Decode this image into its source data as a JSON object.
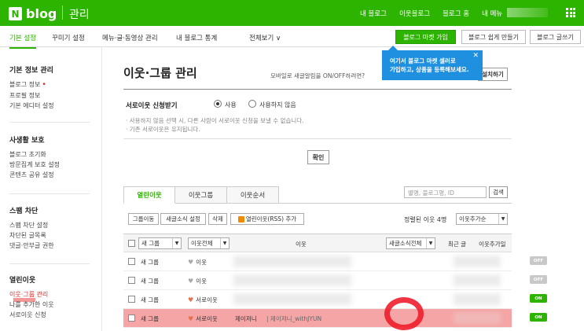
{
  "topbar": {
    "logo_n": "N",
    "logo_text": "blog",
    "title": "관리",
    "links": [
      "내 블로그",
      "이웃블로그",
      "블로그 홈",
      "내 메뉴"
    ],
    "bg_color": "#2db400"
  },
  "subnav": {
    "items": [
      "기본 설정",
      "꾸미기 설정",
      "메뉴·글·동영상 관리",
      "내 블로그 통계",
      "전체보기 ∨"
    ],
    "market_button": "블로그 마켓 가입",
    "easy_button": "블로그 쉽게 만들기",
    "write_button": "블로그 글쓰기"
  },
  "tooltip": {
    "line1": "여기서 블로그 마켓 셀러로",
    "line2": "가입하고, 상품을 등록해보세요.",
    "close": "✕"
  },
  "sidebar": {
    "group1": {
      "title": "기본 정보 관리",
      "items": [
        "블로그 정보",
        "프로필 정보",
        "기본 에디터 설정"
      ]
    },
    "group2": {
      "title": "사생활 보호",
      "items": [
        "블로그 초기화",
        "방문집계 보호 설정",
        "콘텐츠 공유 설정"
      ]
    },
    "group3": {
      "title": "스팸 차단",
      "items": [
        "스팸 차단 설정",
        "차단된 글목록",
        "댓글·안부글 권한"
      ]
    },
    "group4": {
      "title": "열린이웃",
      "items": [
        "이웃·그룹 관리",
        "나를 추가한 이웃",
        "서로이웃 신청"
      ]
    }
  },
  "main": {
    "title": "이웃·그룹 관리",
    "notice": "모바일로 새글알림을 ON/OFF하려면?",
    "install_button": "설치하기",
    "option_label": "서로이웃 신청받기",
    "radio_use": "사용",
    "radio_nouse": "사용하지 않음",
    "desc1": "· 사용하지 않음 선택 시, 다른 사람이 서로이웃 신청을 보낼 수 없습니다.",
    "desc2": "· 기존 서로이웃은 유지됩니다.",
    "confirm": "확인"
  },
  "tabs": [
    "열린이웃",
    "이웃그룹",
    "이웃순서"
  ],
  "search": {
    "placeholder": "별명, 블로그명, ID",
    "button": "검색"
  },
  "toolbar": {
    "group_move": "그룹이동",
    "feed_setting": "새글소식 설정",
    "delete": "삭제",
    "rss_add": "열린이웃(RSS) 추가",
    "sort_text": "정렬된 이웃 4명",
    "sort_select": "이웃추가순"
  },
  "table": {
    "headers": {
      "group_select": "새 그룹",
      "neighbor_all": "이웃전체",
      "neighbor": "이웃",
      "feed_all": "새글소식전체",
      "recent": "최근 글",
      "added_date": "이웃추가일"
    },
    "rows": [
      {
        "group": "새 그룹",
        "type": "이웃",
        "name": "",
        "feed": "OFF"
      },
      {
        "group": "새 그룹",
        "type": "이웃",
        "name": "",
        "feed": "OFF"
      },
      {
        "group": "새 그룹",
        "type": "서로이웃",
        "name": "",
        "feed": "ON"
      },
      {
        "group": "새 그룹",
        "type": "서로이웃",
        "name": "제이져니",
        "blog": "제이져니_withJYUN",
        "feed": "ON"
      }
    ]
  }
}
